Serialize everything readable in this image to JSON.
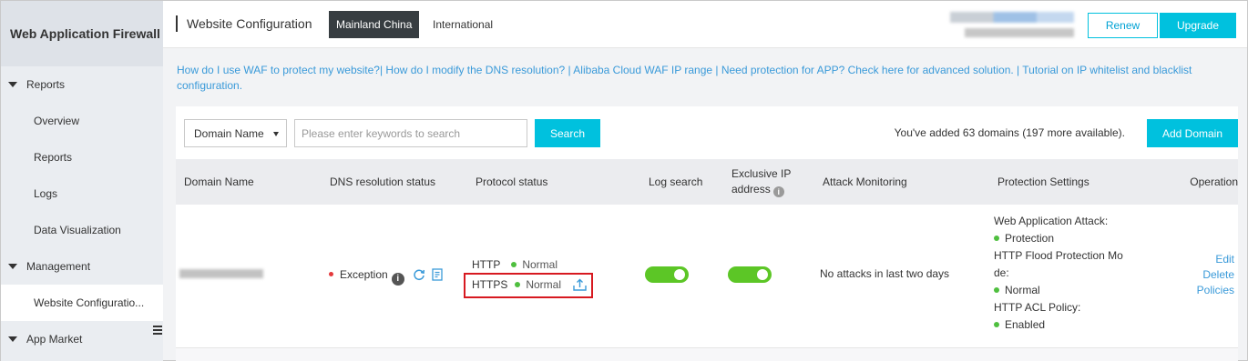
{
  "sidebar": {
    "title": "Web Application Firewall",
    "groups": [
      {
        "label": "Reports",
        "items": [
          "Overview",
          "Reports",
          "Logs",
          "Data Visualization"
        ]
      },
      {
        "label": "Management",
        "items": [
          "Website Configuratio..."
        ]
      },
      {
        "label": "App Market",
        "items": []
      }
    ]
  },
  "header": {
    "title": "Website Configuration",
    "tabs": [
      {
        "label": "Mainland China",
        "active": true
      },
      {
        "label": "International",
        "active": false
      }
    ],
    "renew_label": "Renew",
    "upgrade_label": "Upgrade"
  },
  "help_text": "How do I use WAF to protect my website?| How do I modify the DNS resolution? | Alibaba Cloud WAF IP range | Need protection for APP? Check here for advanced solution. | Tutorial on IP whitelist and blacklist configuration.",
  "toolbar": {
    "select_value": "Domain Name",
    "search_placeholder": "Please enter keywords to search",
    "search_label": "Search",
    "domain_count_text": "You've added 63 domains (197 more available).",
    "add_domain_label": "Add Domain"
  },
  "table": {
    "headers": {
      "domain": "Domain Name",
      "dns": "DNS resolution status",
      "protocol": "Protocol status",
      "log": "Log search",
      "exclusive_ip": "Exclusive IP address",
      "attack": "Attack Monitoring",
      "protection": "Protection Settings",
      "operation": "Operation"
    },
    "row": {
      "dns_status": "Exception",
      "http_label": "HTTP",
      "http_status": "Normal",
      "https_label": "HTTPS",
      "https_status": "Normal",
      "log_search_enabled": true,
      "exclusive_ip_enabled": true,
      "attack_monitoring": "No attacks in last two days",
      "protection": {
        "web_attack_label": "Web Application Attack:",
        "web_attack_value": "Protection",
        "flood_label": "HTTP Flood Protection Mo de:",
        "flood_value": "Normal",
        "acl_label": "HTTP ACL Policy:",
        "acl_value": "Enabled"
      },
      "operations": {
        "edit": "Edit",
        "delete": "Delete",
        "policies": "Policies"
      }
    }
  },
  "colors": {
    "accent": "#00c1de",
    "link": "#3a9ad9",
    "active_tab": "#373d41",
    "status_ok": "#4fbf3f",
    "status_error": "#e4393c",
    "highlight_box": "#d71920"
  }
}
